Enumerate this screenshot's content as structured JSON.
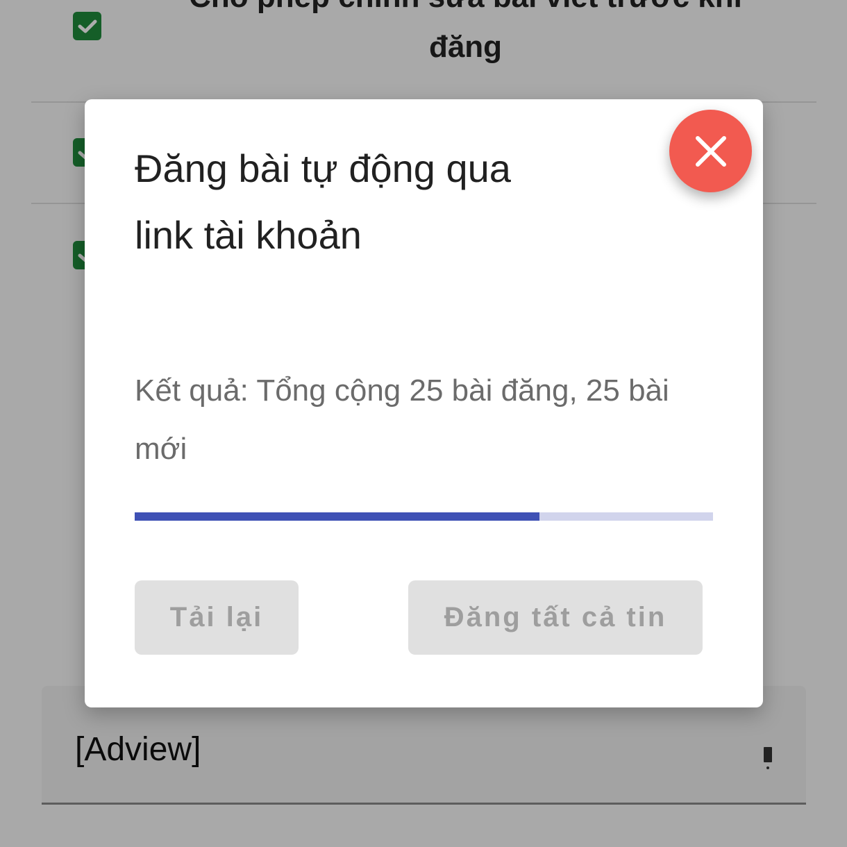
{
  "settings": {
    "items": [
      {
        "label": "Cho phép chỉnh sửa bài viết trước khi đăng",
        "checked": true
      },
      {
        "label": "",
        "checked": true
      },
      {
        "label": "",
        "checked": true
      }
    ]
  },
  "adview": {
    "label": "[Adview]",
    "icon": "info-icon"
  },
  "dialog": {
    "title": "Đăng bài tự động qua link tài khoản",
    "result_text": "Kết quả: Tổng cộng 25 bài đăng, 25 bài mới",
    "progress_percent": 70,
    "buttons": {
      "reload": "Tải lại",
      "post_all": "Đăng tất cả tin"
    },
    "close_icon": "close-icon"
  },
  "colors": {
    "accent": "#3f51b5",
    "progress_track": "#d1d4ec",
    "close_button": "#f25a50",
    "checkbox": "#1f8b3c",
    "disabled_button_bg": "#e0e0e0",
    "disabled_button_text": "#9e9e9e"
  }
}
